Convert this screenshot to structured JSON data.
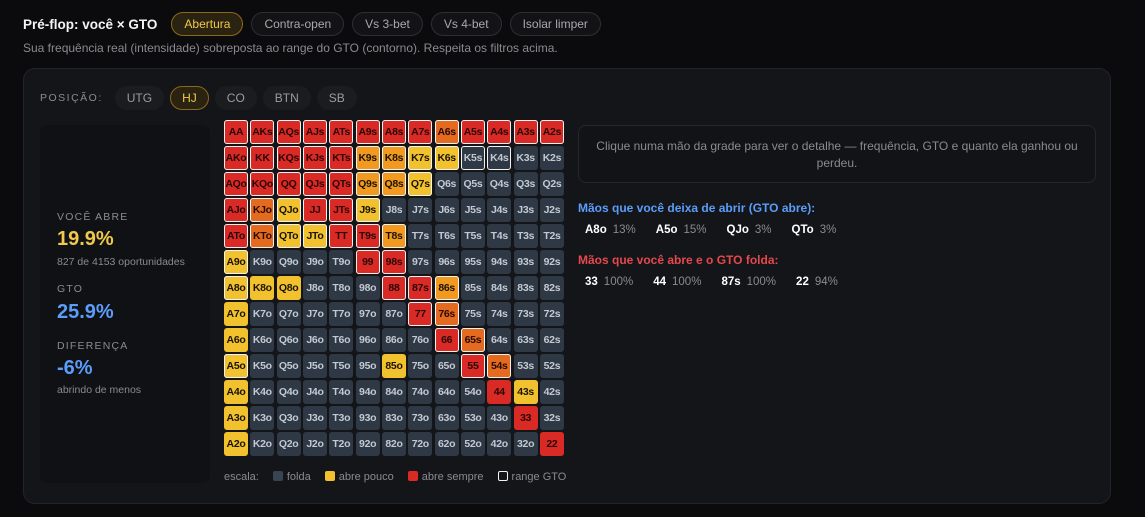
{
  "header": {
    "title": "Pré-flop: você × GTO",
    "tabs": [
      {
        "label": "Abertura",
        "active": true
      },
      {
        "label": "Contra-open",
        "active": false
      },
      {
        "label": "Vs 3-bet",
        "active": false
      },
      {
        "label": "Vs 4-bet",
        "active": false
      },
      {
        "label": "Isolar limper",
        "active": false
      }
    ],
    "subtitle": "Sua frequência real (intensidade) sobreposta ao range do GTO (contorno). Respeita os filtros acima."
  },
  "positions": {
    "label": "POSIÇÃO:",
    "items": [
      {
        "label": "UTG",
        "active": false
      },
      {
        "label": "HJ",
        "active": true
      },
      {
        "label": "CO",
        "active": false
      },
      {
        "label": "BTN",
        "active": false
      },
      {
        "label": "SB",
        "active": false
      }
    ]
  },
  "stats": {
    "you_open_label": "VOCÊ ABRE",
    "you_open_value": "19.9%",
    "opportunities": "827 de 4153 oportunidades",
    "gto_label": "GTO",
    "gto_value": "25.9%",
    "diff_label": "DIFERENÇA",
    "diff_value": "-6%",
    "diff_note": "abrindo de menos"
  },
  "colors": {
    "fold": "#2f3845",
    "low": "#f2c12e",
    "mid": "#f29a1f",
    "high": "#e36a1f",
    "max": "#d92a25",
    "gto_outline": "#f2f2f2",
    "accent_blue": "#5b9dfa",
    "accent_red": "#e5484d"
  },
  "grid": {
    "rows": [
      [
        "AA",
        "AKs",
        "AQs",
        "AJs",
        "ATs",
        "A9s",
        "A8s",
        "A7s",
        "A6s",
        "A5s",
        "A4s",
        "A3s",
        "A2s"
      ],
      [
        "AKo",
        "KK",
        "KQs",
        "KJs",
        "KTs",
        "K9s",
        "K8s",
        "K7s",
        "K6s",
        "K5s",
        "K4s",
        "K3s",
        "K2s"
      ],
      [
        "AQo",
        "KQo",
        "QQ",
        "QJs",
        "QTs",
        "Q9s",
        "Q8s",
        "Q7s",
        "Q6s",
        "Q5s",
        "Q4s",
        "Q3s",
        "Q2s"
      ],
      [
        "AJo",
        "KJo",
        "QJo",
        "JJ",
        "JTs",
        "J9s",
        "J8s",
        "J7s",
        "J6s",
        "J5s",
        "J4s",
        "J3s",
        "J2s"
      ],
      [
        "ATo",
        "KTo",
        "QTo",
        "JTo",
        "TT",
        "T9s",
        "T8s",
        "T7s",
        "T6s",
        "T5s",
        "T4s",
        "T3s",
        "T2s"
      ],
      [
        "A9o",
        "K9o",
        "Q9o",
        "J9o",
        "T9o",
        "99",
        "98s",
        "97s",
        "96s",
        "95s",
        "94s",
        "93s",
        "92s"
      ],
      [
        "A8o",
        "K8o",
        "Q8o",
        "J8o",
        "T8o",
        "98o",
        "88",
        "87s",
        "86s",
        "85s",
        "84s",
        "83s",
        "82s"
      ],
      [
        "A7o",
        "K7o",
        "Q7o",
        "J7o",
        "T7o",
        "97o",
        "87o",
        "77",
        "76s",
        "75s",
        "74s",
        "73s",
        "72s"
      ],
      [
        "A6o",
        "K6o",
        "Q6o",
        "J6o",
        "T6o",
        "96o",
        "86o",
        "76o",
        "66",
        "65s",
        "64s",
        "63s",
        "62s"
      ],
      [
        "A5o",
        "K5o",
        "Q5o",
        "J5o",
        "T5o",
        "95o",
        "85o",
        "75o",
        "65o",
        "55",
        "54s",
        "53s",
        "52s"
      ],
      [
        "A4o",
        "K4o",
        "Q4o",
        "J4o",
        "T4o",
        "94o",
        "84o",
        "74o",
        "64o",
        "54o",
        "44",
        "43s",
        "42s"
      ],
      [
        "A3o",
        "K3o",
        "Q3o",
        "J3o",
        "T3o",
        "93o",
        "83o",
        "73o",
        "63o",
        "53o",
        "43o",
        "33",
        "32s"
      ],
      [
        "A2o",
        "K2o",
        "Q2o",
        "J2o",
        "T2o",
        "92o",
        "82o",
        "72o",
        "62o",
        "52o",
        "42o",
        "32o",
        "22"
      ]
    ],
    "freq": [
      [
        4,
        4,
        4,
        4,
        4,
        4,
        4,
        4,
        3,
        4,
        4,
        4,
        4
      ],
      [
        4,
        4,
        4,
        4,
        4,
        2,
        2,
        1,
        1,
        0,
        0,
        0,
        0
      ],
      [
        4,
        4,
        4,
        4,
        4,
        2,
        2,
        1,
        0,
        0,
        0,
        0,
        0
      ],
      [
        4,
        3,
        1,
        4,
        4,
        1,
        0,
        0,
        0,
        0,
        0,
        0,
        0
      ],
      [
        4,
        3,
        1,
        1,
        4,
        4,
        2,
        0,
        0,
        0,
        0,
        0,
        0
      ],
      [
        1,
        0,
        0,
        0,
        0,
        4,
        4,
        0,
        0,
        0,
        0,
        0,
        0
      ],
      [
        1,
        1,
        1,
        0,
        0,
        0,
        4,
        4,
        2,
        0,
        0,
        0,
        0
      ],
      [
        1,
        0,
        0,
        0,
        0,
        0,
        0,
        4,
        3,
        0,
        0,
        0,
        0
      ],
      [
        1,
        0,
        0,
        0,
        0,
        0,
        0,
        0,
        4,
        3,
        0,
        0,
        0
      ],
      [
        1,
        0,
        0,
        0,
        0,
        0,
        1,
        0,
        0,
        4,
        3,
        0,
        0
      ],
      [
        1,
        0,
        0,
        0,
        0,
        0,
        0,
        0,
        0,
        0,
        4,
        1,
        0
      ],
      [
        1,
        0,
        0,
        0,
        0,
        0,
        0,
        0,
        0,
        0,
        0,
        4,
        0
      ],
      [
        1,
        0,
        0,
        0,
        0,
        0,
        0,
        0,
        0,
        0,
        0,
        0,
        4
      ]
    ],
    "gto": [
      [
        1,
        1,
        1,
        1,
        1,
        1,
        1,
        1,
        1,
        1,
        1,
        1,
        1
      ],
      [
        1,
        1,
        1,
        1,
        1,
        1,
        1,
        1,
        1,
        1,
        1,
        0,
        0
      ],
      [
        1,
        1,
        1,
        1,
        1,
        1,
        1,
        1,
        0,
        0,
        0,
        0,
        0
      ],
      [
        1,
        1,
        1,
        1,
        1,
        1,
        0,
        0,
        0,
        0,
        0,
        0,
        0
      ],
      [
        1,
        1,
        1,
        1,
        1,
        1,
        1,
        0,
        0,
        0,
        0,
        0,
        0
      ],
      [
        1,
        0,
        0,
        0,
        0,
        1,
        1,
        0,
        0,
        0,
        0,
        0,
        0
      ],
      [
        1,
        0,
        0,
        0,
        0,
        0,
        1,
        1,
        1,
        0,
        0,
        0,
        0
      ],
      [
        0,
        0,
        0,
        0,
        0,
        0,
        0,
        1,
        1,
        0,
        0,
        0,
        0
      ],
      [
        0,
        0,
        0,
        0,
        0,
        0,
        0,
        0,
        1,
        1,
        0,
        0,
        0
      ],
      [
        1,
        0,
        0,
        0,
        0,
        0,
        0,
        0,
        0,
        1,
        1,
        0,
        0
      ],
      [
        0,
        0,
        0,
        0,
        0,
        0,
        0,
        0,
        0,
        0,
        0,
        0,
        0
      ],
      [
        0,
        0,
        0,
        0,
        0,
        0,
        0,
        0,
        0,
        0,
        0,
        0,
        0
      ],
      [
        0,
        0,
        0,
        0,
        0,
        0,
        0,
        0,
        0,
        0,
        0,
        0,
        0
      ]
    ]
  },
  "legend": {
    "label": "escala:",
    "fold": "folda",
    "low": "abre pouco",
    "high": "abre sempre",
    "gto": "range GTO"
  },
  "detail": {
    "placeholder": "Clique numa mão da grade para ver o detalhe — frequência, GTO e quanto ela ganhou ou perdeu."
  },
  "missing": {
    "title": "Mãos que você deixa de abrir (GTO abre):",
    "hands": [
      {
        "hand": "A8o",
        "pct": "13%"
      },
      {
        "hand": "A5o",
        "pct": "15%"
      },
      {
        "hand": "QJo",
        "pct": "3%"
      },
      {
        "hand": "QTo",
        "pct": "3%"
      }
    ]
  },
  "extra": {
    "title": "Mãos que você abre e o GTO folda:",
    "hands": [
      {
        "hand": "33",
        "pct": "100%"
      },
      {
        "hand": "44",
        "pct": "100%"
      },
      {
        "hand": "87s",
        "pct": "100%"
      },
      {
        "hand": "22",
        "pct": "94%"
      }
    ]
  }
}
